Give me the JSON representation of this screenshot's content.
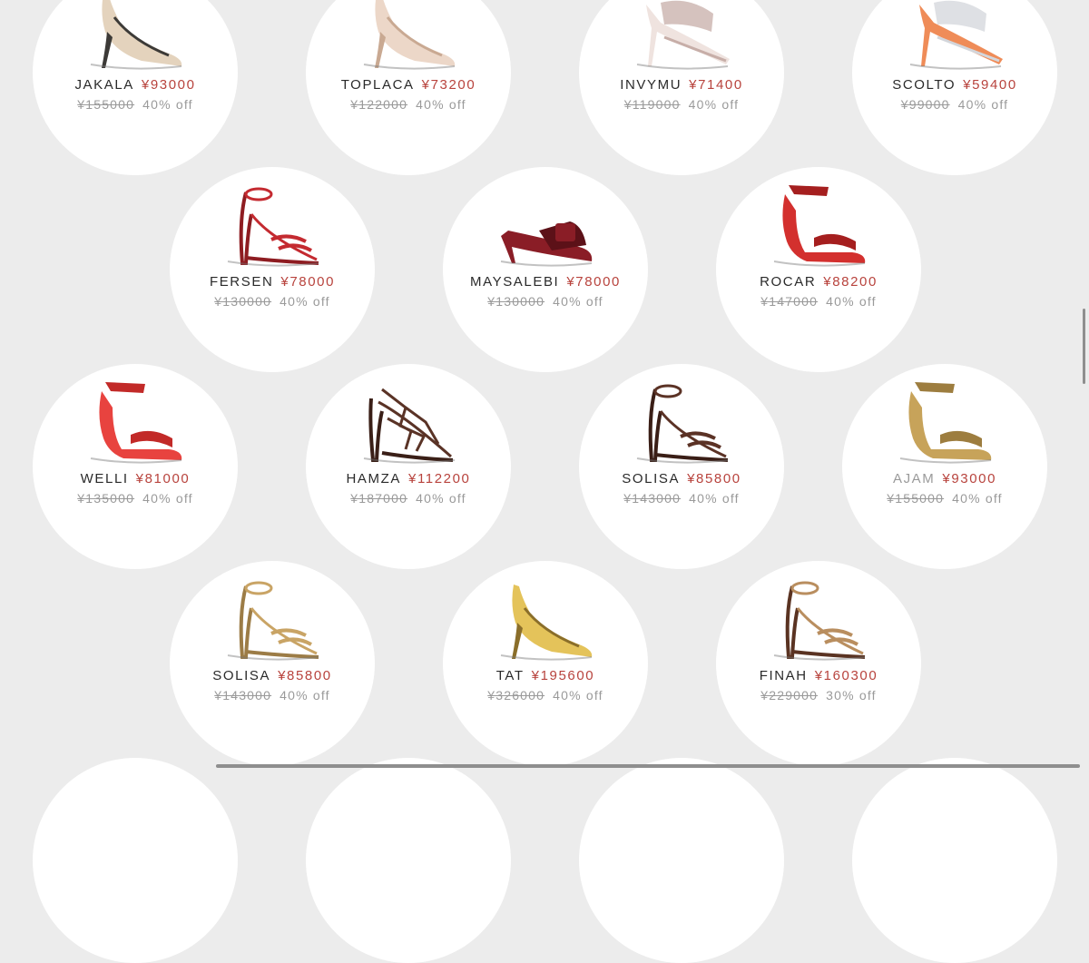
{
  "currency": "¥",
  "products": [
    {
      "name": "JAKALA",
      "price": "¥93000",
      "original_price": "¥155000",
      "discount": "40% off",
      "shoe_style": "pump",
      "colors": [
        "#e4d3bd",
        "#3c3a37"
      ]
    },
    {
      "name": "TOPLACA",
      "price": "¥73200",
      "original_price": "¥122000",
      "discount": "40% off",
      "shoe_style": "pump",
      "colors": [
        "#ecd7c8",
        "#c9a992"
      ]
    },
    {
      "name": "INVYMU",
      "price": "¥71400",
      "original_price": "¥119000",
      "discount": "40% off",
      "shoe_style": "mule",
      "colors": [
        "#efe3df",
        "#c7aea8"
      ]
    },
    {
      "name": "SCOLTO",
      "price": "¥59400",
      "original_price": "¥99000",
      "discount": "40% off",
      "shoe_style": "mule",
      "colors": [
        "#ef8c58",
        "#d3d6db"
      ]
    },
    {
      "name": "FERSEN",
      "price": "¥78000",
      "original_price": "¥130000",
      "discount": "40% off",
      "shoe_style": "sandal",
      "colors": [
        "#c42a30",
        "#8e1c21"
      ]
    },
    {
      "name": "MAYSALEBI",
      "price": "¥78000",
      "original_price": "¥130000",
      "discount": "40% off",
      "shoe_style": "flatmule",
      "colors": [
        "#8a1d26",
        "#5c1118"
      ]
    },
    {
      "name": "ROCAR",
      "price": "¥88200",
      "original_price": "¥147000",
      "discount": "40% off",
      "shoe_style": "wedge",
      "colors": [
        "#d3302e",
        "#a51f1f"
      ]
    },
    {
      "name": "WELLI",
      "price": "¥81000",
      "original_price": "¥135000",
      "discount": "40% off",
      "shoe_style": "wedge",
      "colors": [
        "#e8433f",
        "#c22a28"
      ]
    },
    {
      "name": "HAMZA",
      "price": "¥112200",
      "original_price": "¥187000",
      "discount": "40% off",
      "shoe_style": "cage",
      "colors": [
        "#5a3326",
        "#3a1f17"
      ]
    },
    {
      "name": "SOLISA",
      "price": "¥85800",
      "original_price": "¥143000",
      "discount": "40% off",
      "shoe_style": "sandal",
      "colors": [
        "#5b3225",
        "#3a1e16"
      ]
    },
    {
      "name": "AJAM",
      "price": "¥93000",
      "original_price": "¥155000",
      "discount": "40% off",
      "shoe_style": "wedge",
      "muted": true,
      "colors": [
        "#c7a35a",
        "#9d7d3f"
      ]
    },
    {
      "name": "SOLISA",
      "price": "¥85800",
      "original_price": "¥143000",
      "discount": "40% off",
      "shoe_style": "sandal",
      "colors": [
        "#c9a465",
        "#9c7c46"
      ]
    },
    {
      "name": "TAT",
      "price": "¥195600",
      "original_price": "¥326000",
      "discount": "40% off",
      "shoe_style": "pump",
      "colors": [
        "#e4c35a",
        "#8a6e2a"
      ]
    },
    {
      "name": "FINAH",
      "price": "¥160300",
      "original_price": "¥229000",
      "discount": "30% off",
      "shoe_style": "sandal",
      "colors": [
        "#b98e5f",
        "#5a3322"
      ]
    }
  ]
}
